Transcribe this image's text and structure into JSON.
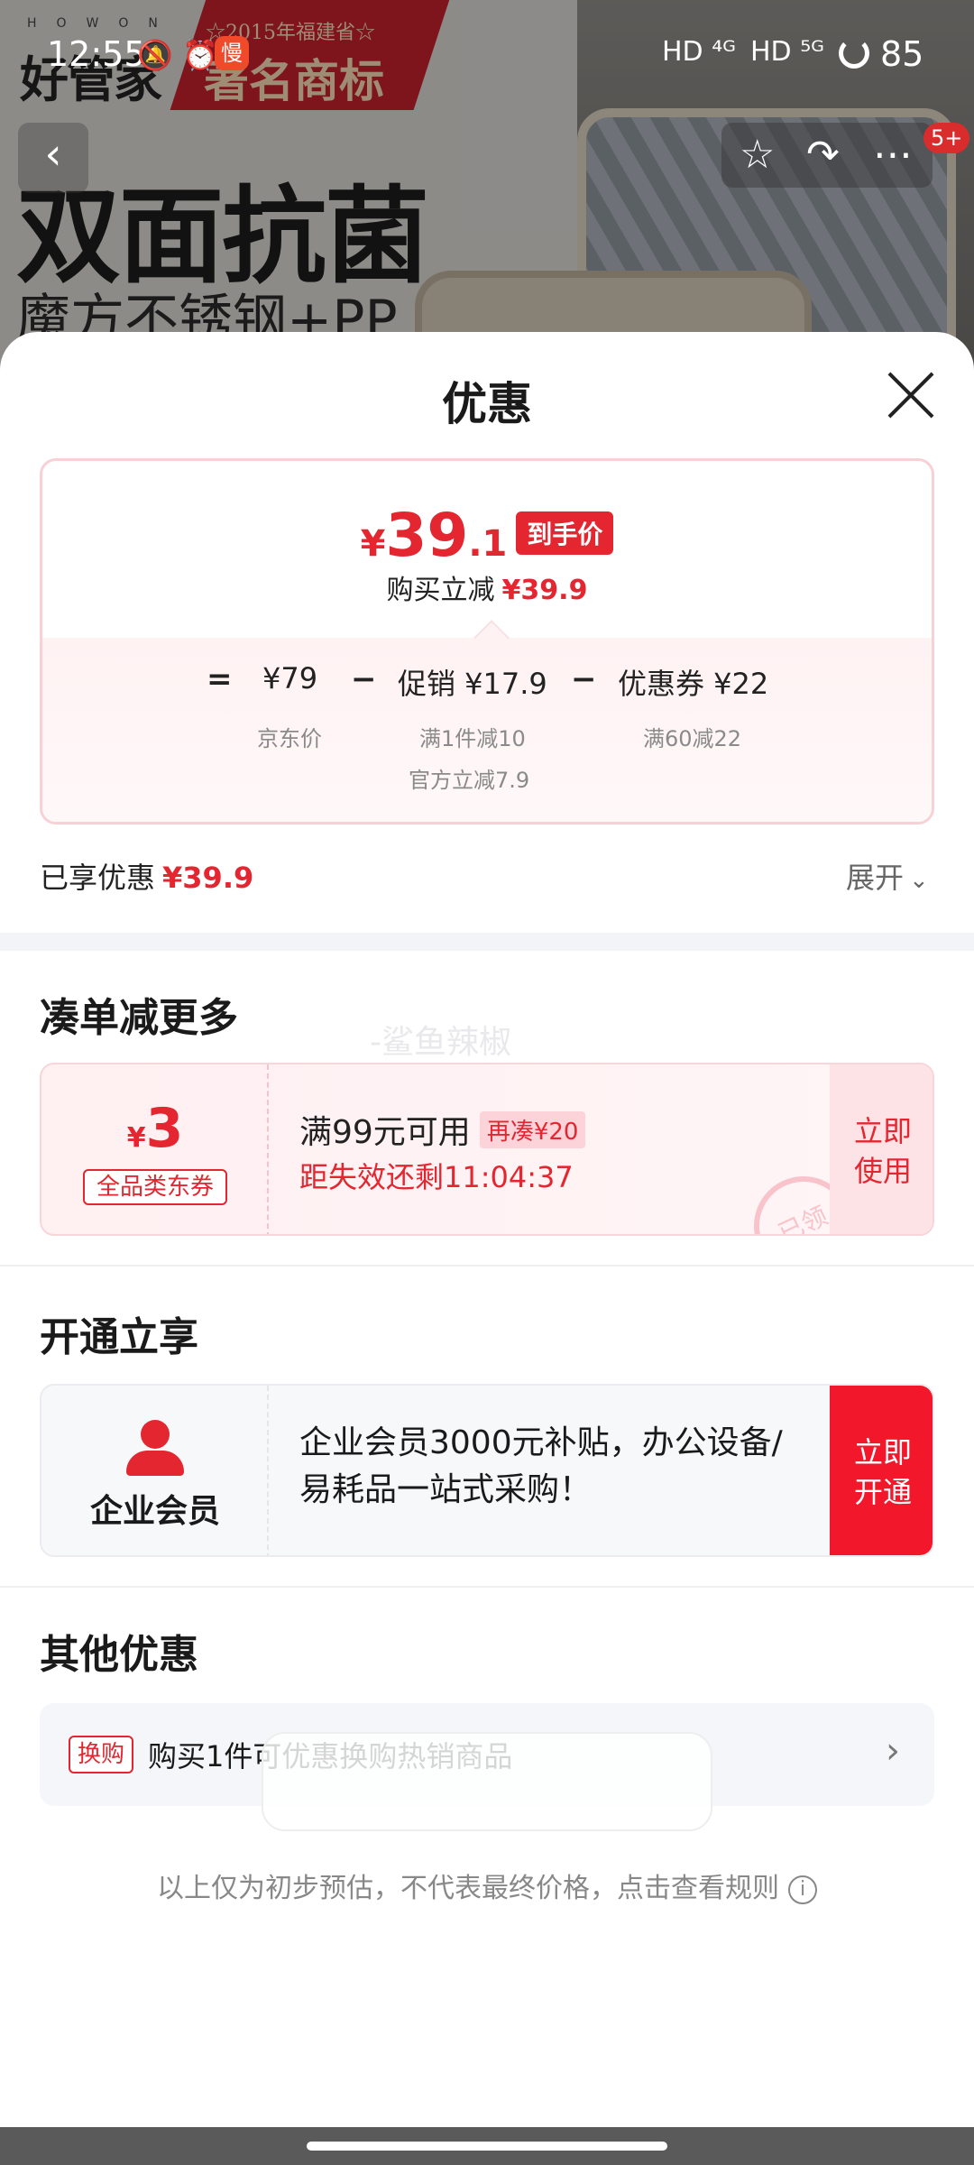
{
  "status_bar": {
    "time": "12:55",
    "left_icons": "🔕 ⏰",
    "app_icon": "慢",
    "signal1": "HD ⁴ᴳ",
    "signal2": "HD ⁵ᴳ",
    "battery": "85"
  },
  "banner": {
    "brand": "好管家",
    "brand_small": "HOWON",
    "ribbon_line1": "☆2015年福建省☆",
    "ribbon_line2": "著名商标",
    "headline": "双面抗菌",
    "subline": "魔方不锈钢+PP",
    "badge": "5+"
  },
  "sheet": {
    "title": "优惠",
    "price": {
      "yen": "¥",
      "int": "39",
      "frac": ".1",
      "tag": "到手价",
      "sub_label": "购买立减",
      "sub_value": "¥39.9"
    },
    "breakdown": {
      "eq": "=",
      "jd_price": "¥79",
      "jd_price_label": "京东价",
      "minus1": "−",
      "promo": "促销 ¥17.9",
      "promo_note1": "满1件减10",
      "promo_note2": "官方立减7.9",
      "minus2": "−",
      "coupon": "优惠券 ¥22",
      "coupon_note": "满60减22"
    },
    "enjoyed_label": "已享优惠",
    "enjoyed_value": "¥39.9",
    "expand_label": "展开",
    "section_more": "凑单减更多",
    "watermark": "-鲨鱼辣椒",
    "coupon": {
      "yen": "¥",
      "amount": "3",
      "type": "全品类东券",
      "condition": "满99元可用",
      "more_tag": "再凑¥20",
      "countdown": "距失效还剩11:04:37",
      "button": "立即\n使用",
      "stamp": "已领"
    },
    "section_open": "开通立享",
    "member": {
      "name": "企业会员",
      "desc": "企业会员3000元补贴，办公设备/易耗品一站式采购！",
      "button": "立即\n开通"
    },
    "section_other": "其他优惠",
    "other": {
      "tag": "换购",
      "text": "购买1件可优惠换购热销商品"
    },
    "disclaimer": "以上仅为初步预估，不代表最终价格，点击查看规则"
  }
}
